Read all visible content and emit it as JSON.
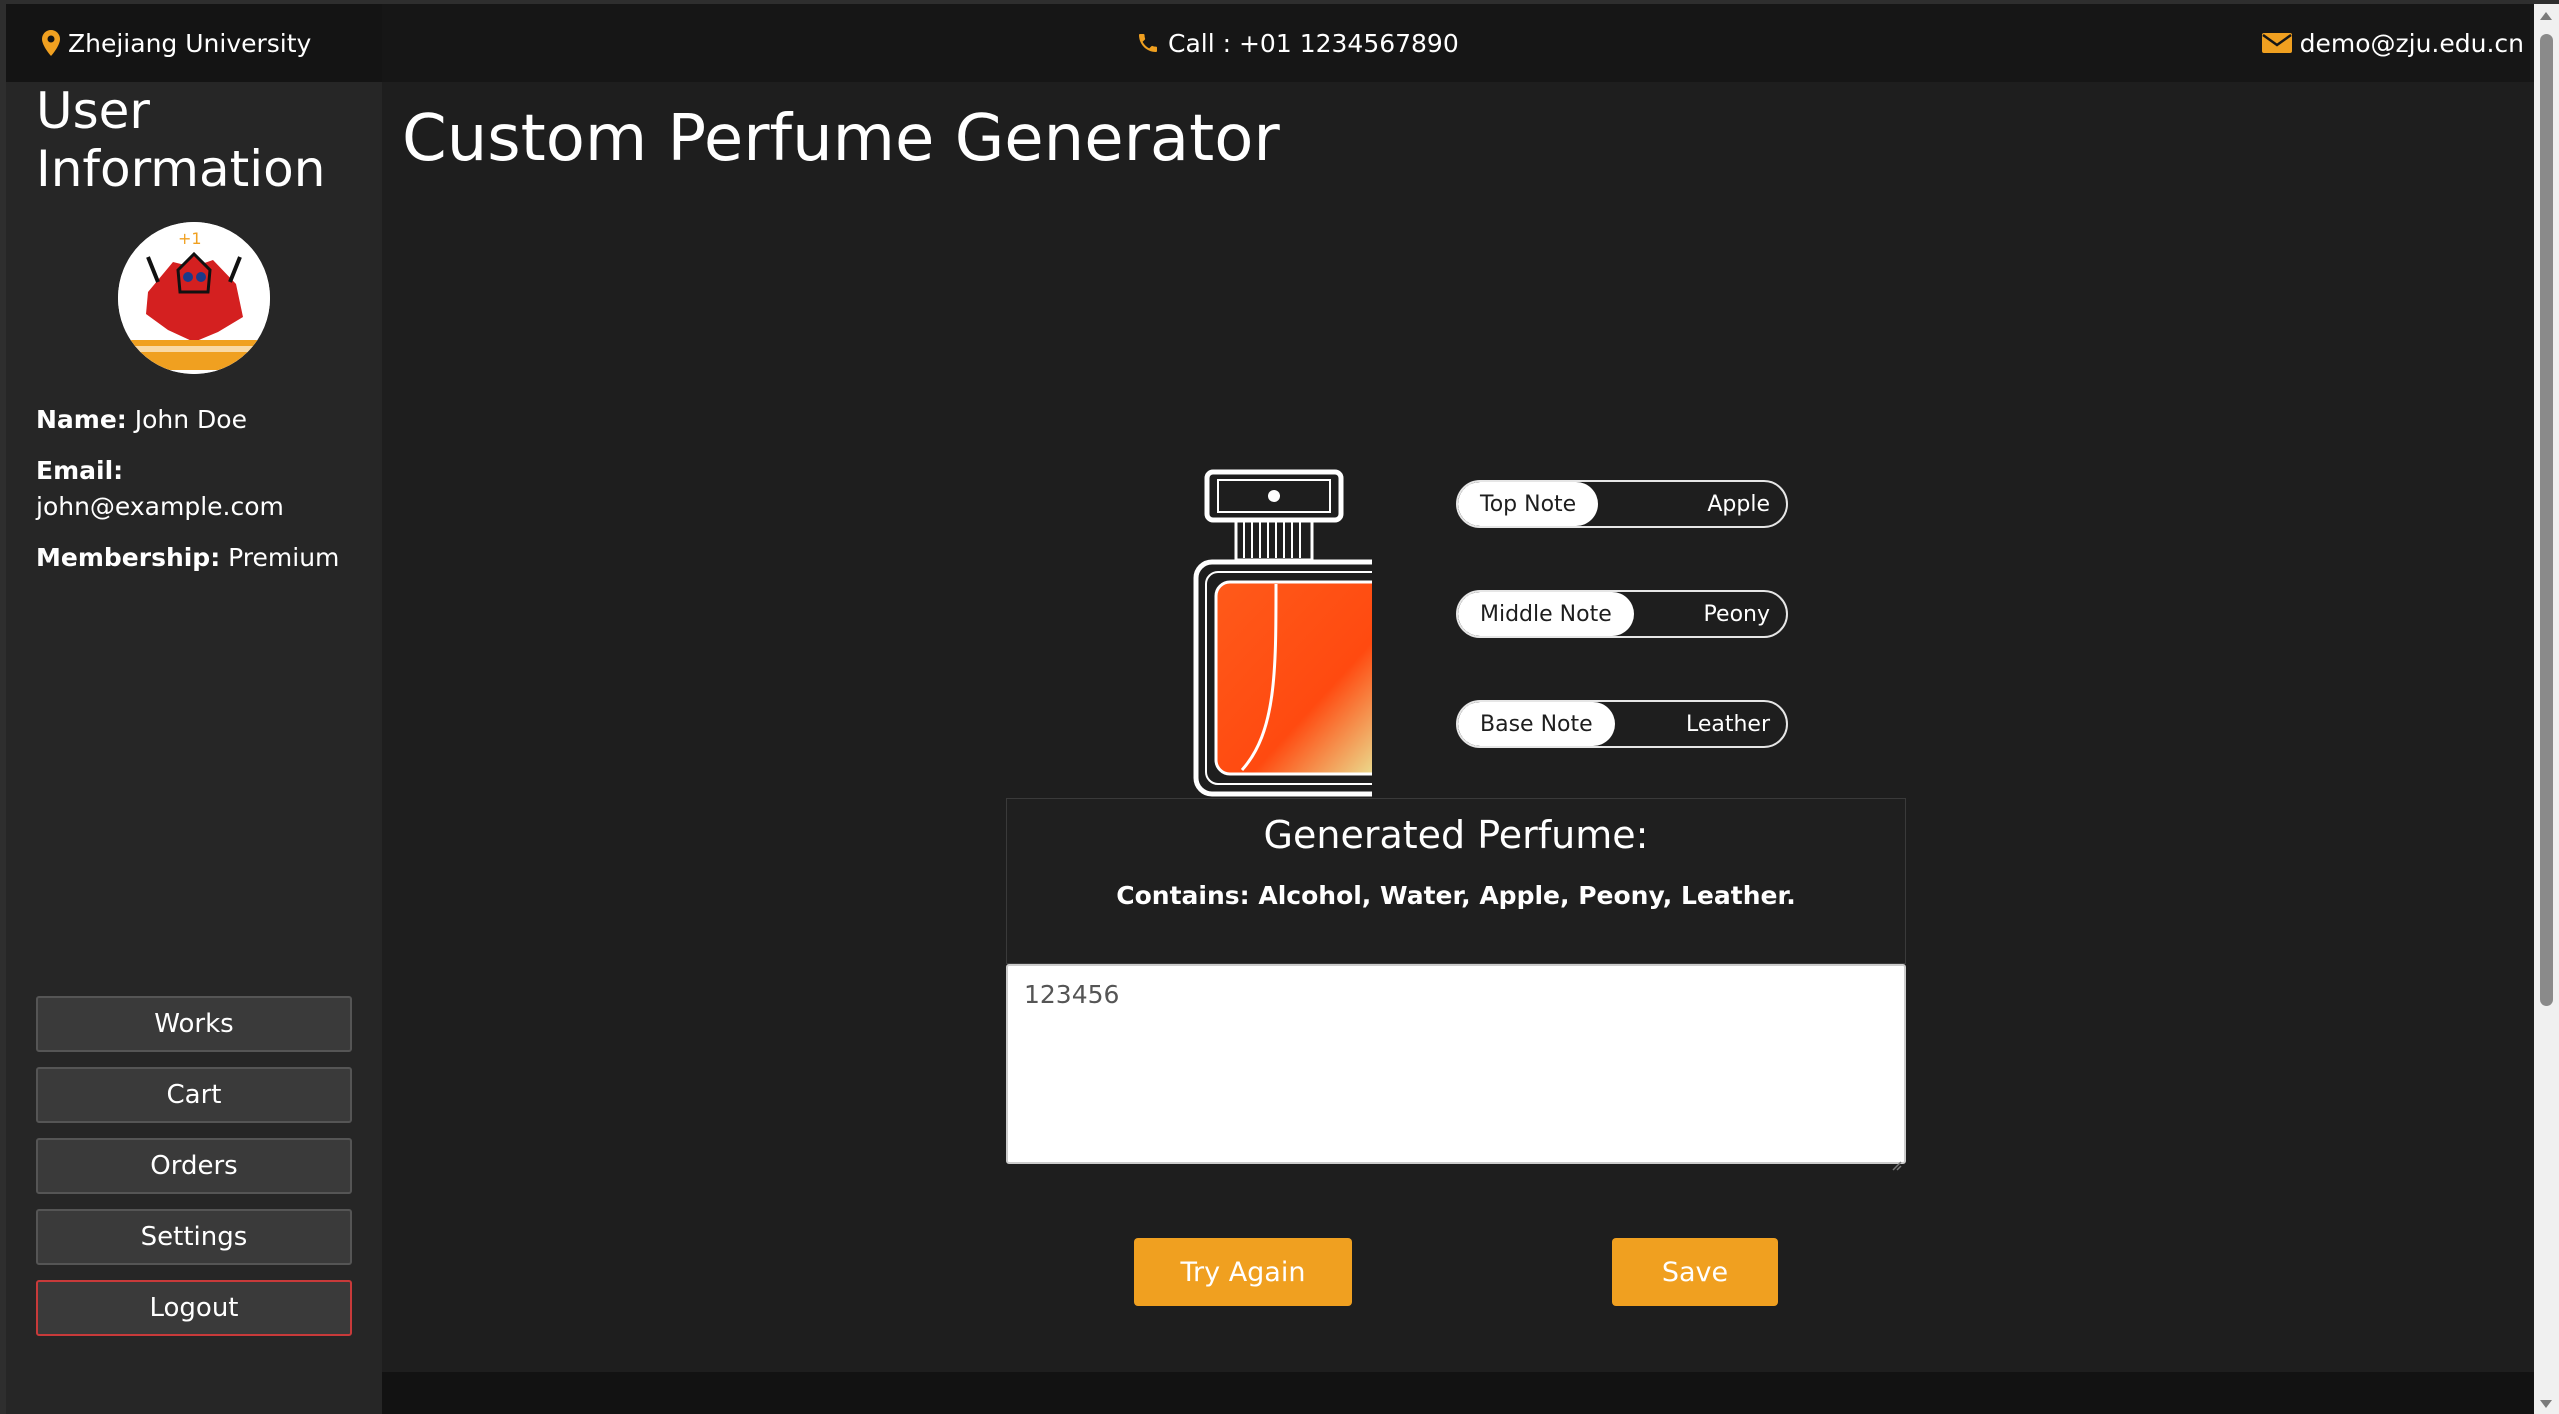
{
  "topbar": {
    "location": "Zhejiang University",
    "phone": "Call : +01 1234567890",
    "email": "demo@zju.edu.cn",
    "icon_color": "#f0a020"
  },
  "sidebar": {
    "title": "User Information",
    "user": {
      "name_label": "Name:",
      "name_value": "John Doe",
      "email_label": "Email:",
      "email_value": "john@example.com",
      "membership_label": "Membership:",
      "membership_value": "Premium"
    },
    "nav": [
      "Works",
      "Cart",
      "Orders",
      "Settings",
      "Logout"
    ]
  },
  "main": {
    "title": "Custom Perfume Generator",
    "notes": [
      {
        "label": "Top Note",
        "value": "Apple"
      },
      {
        "label": "Middle Note",
        "value": "Peony"
      },
      {
        "label": "Base Note",
        "value": "Leather"
      }
    ],
    "result_title": "Generated Perfume:",
    "result_contains": "Contains: Alcohol, Water, Apple, Peony, Leather.",
    "textarea_value": "123456",
    "try_again_label": "Try Again",
    "save_label": "Save"
  },
  "colors": {
    "accent": "#f0a020",
    "background": "#1e1e1e",
    "sidebar": "#262626",
    "logout_border": "#c83a3a"
  }
}
